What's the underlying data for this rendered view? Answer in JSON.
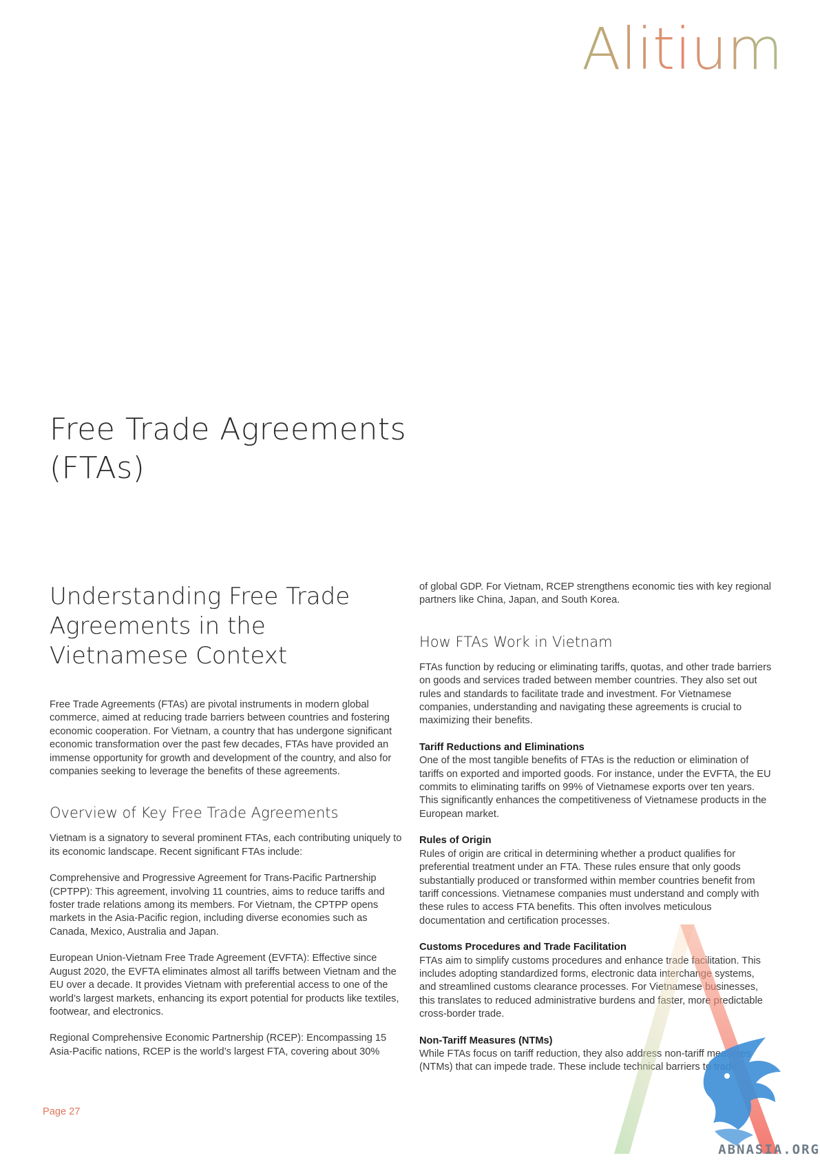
{
  "logo": {
    "text": "Alitium",
    "color_start": "#b5b07a",
    "color_mid": "#e58a6e",
    "color_end": "#a9bf8c"
  },
  "chapter_title": "Free Trade Agreements (FTAs)",
  "left_column": {
    "section_title": "Understanding Free Trade Agreements in the Vietnamese Context",
    "intro": "Free Trade Agreements (FTAs) are pivotal instruments in modern global commerce, aimed at reducing trade barriers between countries and fostering economic cooperation. For Vietnam, a country that has undergone significant economic transformation over the past few decades, FTAs have provided an immense opportunity for growth and development of the country, and also for companies seeking to leverage the benefits of these agreements.",
    "overview_title": "Overview of Key Free Trade Agreements",
    "overview_intro": "Vietnam is a signatory to several prominent FTAs, each contributing uniquely to its economic landscape. Recent significant FTAs include:",
    "cptpp": "Comprehensive and Progressive Agreement for Trans-Pacific Partnership (CPTPP): This agreement, involving 11 countries, aims to reduce tariffs and foster trade relations among its members. For Vietnam, the CPTPP opens markets in the Asia-Pacific region, including diverse economies such as Canada, Mexico, Australia and Japan.",
    "evfta": "European Union-Vietnam Free Trade Agreement (EVFTA): Effective since August 2020, the EVFTA eliminates almost all tariffs between Vietnam and the EU over a decade. It provides Vietnam with preferential access to one of the world’s largest markets, enhancing its export potential for products like textiles, footwear, and electronics.",
    "rcep": "Regional Comprehensive Economic Partnership (RCEP): Encompassing 15 Asia-Pacific nations, RCEP is the world’s largest FTA, covering about 30%"
  },
  "right_column": {
    "rcep_continued": "of global GDP. For Vietnam, RCEP strengthens economic ties with key regional partners like China, Japan, and South Korea.",
    "how_title": "How FTAs Work in Vietnam",
    "how_intro": "FTAs function by reducing or eliminating tariffs, quotas, and other trade barriers on goods and services traded between member countries. They also set out rules and standards to facilitate trade and investment. For Vietnamese companies, understanding and navigating these agreements is crucial to maximizing their benefits.",
    "tariff_heading": "Tariff Reductions and Eliminations",
    "tariff_text": "One of the most tangible benefits of FTAs is the reduction or elimination of tariffs on exported and imported goods. For instance, under the EVFTA, the EU commits to eliminating tariffs on 99% of Vietnamese exports over ten years. This significantly enhances the competitiveness of Vietnamese products in the European market.",
    "origin_heading": "Rules of Origin",
    "origin_text": "Rules of origin are critical in determining whether a product qualifies for preferential treatment under an FTA. These rules ensure that only goods substantially produced or transformed within member countries benefit from tariff concessions. Vietnamese companies must understand and comply with these rules to access FTA benefits. This often involves meticulous documentation and certification processes.",
    "customs_heading": "Customs Procedures and Trade Facilitation",
    "customs_text": "FTAs aim to simplify customs procedures and enhance trade facilitation. This includes adopting standardized forms, electronic data interchange systems, and streamlined customs clearance processes. For Vietnamese businesses, this translates to reduced administrative burdens and faster, more predictable cross-border trade.",
    "ntm_heading": "Non-Tariff Measures (NTMs)",
    "ntm_text": "While FTAs focus on tariff reduction, they also address non-tariff measures (NTMs) that can impede trade. These include technical barriers to trade"
  },
  "footer": {
    "page_label": "Page 27"
  },
  "watermark": {
    "text": "ABNASIA.ORG",
    "icon": "griffin-icon"
  }
}
